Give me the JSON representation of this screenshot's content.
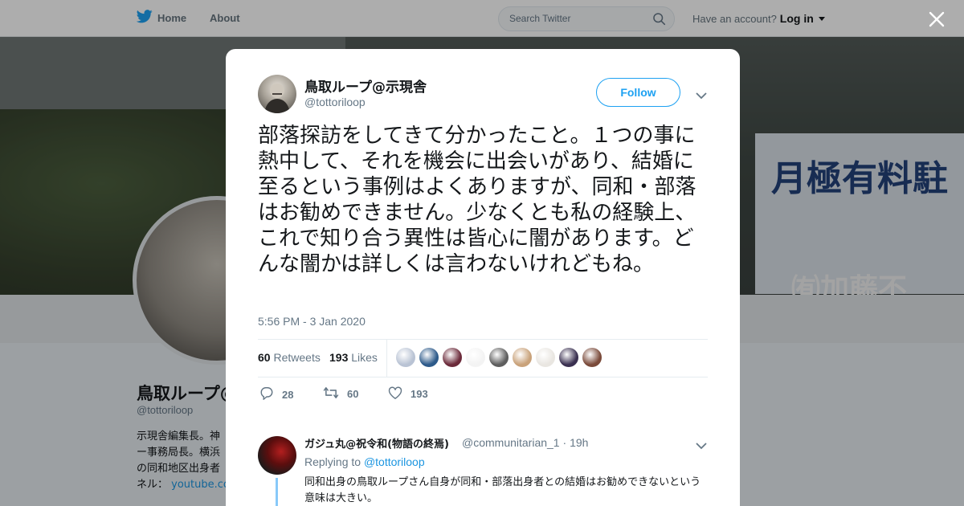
{
  "nav": {
    "home_label": "Home",
    "about_label": "About",
    "search_placeholder": "Search Twitter",
    "account_prompt": "Have an account?",
    "login_label": "Log in"
  },
  "background_profile": {
    "name": "鳥取ループ@",
    "handle": "@tottoriloop",
    "bio_lines": [
      "示現舎編集長。神",
      "ー事務局長。横浜",
      "の同和地区出身者"
    ],
    "bio_link_prefix": "ネル：",
    "bio_link": "youtube.co",
    "banner_sign_text": "月極有料駐",
    "banner_sign_text2": "㈲加藤不"
  },
  "tweet": {
    "author_name": "鳥取ループ@示現舎",
    "author_handle": "@tottoriloop",
    "follow_label": "Follow",
    "text": "部落探訪をしてきて分かったこと。１つの事に熱中して、それを機会に出会いがあり、結婚に至るという事例はよくありますが、同和・部落はお勧めできません。少なくとも私の経験上、これで知り合う異性は皆心に闇があります。どんな闇かは詳しくは言わないけれどもね。",
    "timestamp": "5:56 PM - 3 Jan 2020",
    "retweets_count": "60",
    "retweets_label": "Retweets",
    "likes_count": "193",
    "likes_label": "Likes",
    "liker_colors": [
      "#b9c3d4",
      "#2d5a8a",
      "#6b2a3a",
      "#f3f3f3",
      "#5e5e5e",
      "#c9a27a",
      "#e9e6e1",
      "#3a3050",
      "#7a4a3a"
    ],
    "actions": {
      "reply_count": "28",
      "retweet_count": "60",
      "like_count": "193"
    }
  },
  "reply": {
    "author_name": "ガジュ丸@祝令和(物語の終焉)",
    "author_handle": "@communitarian_1",
    "time": "19h",
    "replying_prefix": "Replying to",
    "replying_to": "@tottoriloop",
    "text": "同和出身の鳥取ループさん自身が同和・部落出身者との結婚はお勧めできないという意味は大きい。"
  },
  "colors": {
    "accent": "#1da1f2",
    "link": "#1b95e0",
    "muted": "#657786",
    "text": "#14171a"
  }
}
